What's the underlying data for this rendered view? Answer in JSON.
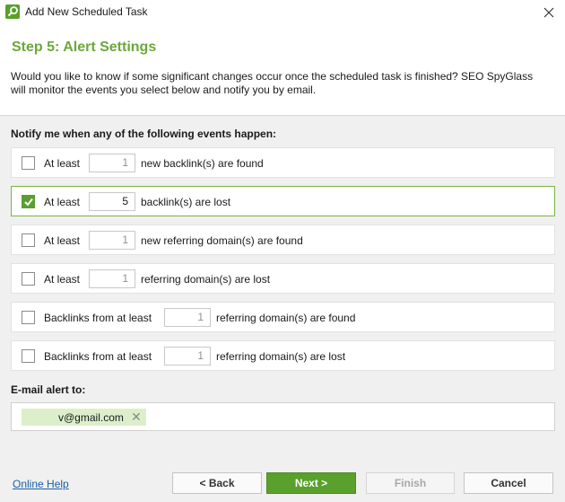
{
  "window": {
    "title": "Add New Scheduled Task"
  },
  "header": {
    "step_title": "Step 5: Alert Settings",
    "description": "Would you like to know if some significant changes occur once the scheduled task is finished? SEO SpyGlass will monitor the events you select below and notify you by email."
  },
  "events_label": "Notify me when any of the following events happen:",
  "events": [
    {
      "checked": false,
      "prefix": "At least",
      "value": "1",
      "suffix": "new backlink(s) are found"
    },
    {
      "checked": true,
      "prefix": "At least",
      "value": "5",
      "suffix": "backlink(s) are lost"
    },
    {
      "checked": false,
      "prefix": "At least",
      "value": "1",
      "suffix": "new referring domain(s) are found"
    },
    {
      "checked": false,
      "prefix": "At least",
      "value": "1",
      "suffix": "referring domain(s) are lost"
    },
    {
      "checked": false,
      "prefix": "Backlinks from at least",
      "value": "1",
      "suffix": "referring domain(s) are found"
    },
    {
      "checked": false,
      "prefix": "Backlinks from at least",
      "value": "1",
      "suffix": "referring domain(s) are lost"
    }
  ],
  "email": {
    "label": "E-mail alert to:",
    "recipient": "v@gmail.com",
    "remove_glyph": "✕"
  },
  "footer": {
    "help_link": "Online Help",
    "back_label": "< Back",
    "next_label": "Next >",
    "finish_label": "Finish",
    "cancel_label": "Cancel"
  },
  "colors": {
    "accent": "#5aa02c",
    "title": "#6aa83b",
    "link": "#1b5fa8"
  },
  "icons": {
    "app": "spyglass-app-icon",
    "close": "close-icon",
    "check": "checkmark-icon"
  }
}
